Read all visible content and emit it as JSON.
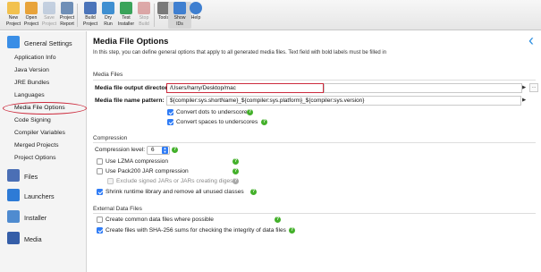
{
  "toolbar": {
    "buttons": [
      {
        "label_1": "New",
        "label_2": "Project",
        "icon": "new-project-icon",
        "color": "#f2c14e",
        "enabled": true
      },
      {
        "label_1": "Open",
        "label_2": "Project",
        "icon": "open-project-icon",
        "color": "#e8a33a",
        "enabled": true
      },
      {
        "label_1": "Save",
        "label_2": "Project",
        "icon": "save-project-icon",
        "color": "#8aa3c7",
        "enabled": false
      },
      {
        "label_1": "Project",
        "label_2": "Report",
        "icon": "project-report-icon",
        "color": "#6f8fb7",
        "enabled": true
      },
      {
        "label_1": "Build",
        "label_2": "Project",
        "icon": "build-project-icon",
        "color": "#4b74b9",
        "enabled": true
      },
      {
        "label_1": "Dry",
        "label_2": "Run",
        "icon": "dry-run-icon",
        "color": "#3f8fd1",
        "enabled": true
      },
      {
        "label_1": "Test",
        "label_2": "Installer",
        "icon": "test-installer-icon",
        "color": "#3aa35a",
        "enabled": true
      },
      {
        "label_1": "Stop",
        "label_2": "Build",
        "icon": "stop-build-icon",
        "color": "#c04b4b",
        "enabled": false
      },
      {
        "label_1": "Tools",
        "label_2": "",
        "icon": "tools-icon",
        "color": "#7a7a7a",
        "enabled": true
      },
      {
        "label_1": "Show",
        "label_2": "IDs",
        "icon": "show-ids-icon",
        "color": "#3f7fd0",
        "enabled": true
      },
      {
        "label_1": "Help",
        "label_2": "",
        "icon": "help-icon",
        "color": "#3f7fd0",
        "enabled": true
      }
    ]
  },
  "sidebar": {
    "groups": [
      {
        "label": "General Settings",
        "icon": "general-settings-icon",
        "color": "#3a8ee6"
      },
      {
        "label": "Files",
        "icon": "files-icon",
        "color": "#4b6fb5"
      },
      {
        "label": "Launchers",
        "icon": "launchers-icon",
        "color": "#2e7bd6"
      },
      {
        "label": "Installer",
        "icon": "installer-icon",
        "color": "#4f8bd0"
      },
      {
        "label": "Media",
        "icon": "media-icon",
        "color": "#355ea8"
      }
    ],
    "items": [
      {
        "label": "Application Info"
      },
      {
        "label": "Java Version"
      },
      {
        "label": "JRE Bundles"
      },
      {
        "label": "Languages"
      },
      {
        "label": "Media File Options"
      },
      {
        "label": "Code Signing"
      },
      {
        "label": "Compiler Variables"
      },
      {
        "label": "Merged Projects"
      },
      {
        "label": "Project Options"
      }
    ]
  },
  "main": {
    "title": "Media File Options",
    "intro": "In this step, you can define general options that apply to all generated media files. Text field with bold labels must be filled in",
    "media_files": {
      "heading": "Media Files",
      "output_dir_label": "Media file output directory:",
      "output_dir_value": "/Users/harry/Desktop/mac",
      "name_pattern_label": "Media file name pattern:",
      "name_pattern_value": "${compiler:sys.shortName}_${compiler:sys.platform}_${compiler:sys.version}",
      "convert_dots": "Convert dots to underscores",
      "convert_spaces": "Convert spaces to underscores"
    },
    "compression": {
      "heading": "Compression",
      "level_label": "Compression level:",
      "level_value": "6",
      "lzma": "Use LZMA compression",
      "pack200": "Use Pack200 JAR compression",
      "exclude_signed": "Exclude signed JARs or JARs creating digests",
      "shrink": "Shrink runtime library and remove all unused classes"
    },
    "external": {
      "heading": "External Data Files",
      "common": "Create common data files where possible",
      "sha256": "Create files with SHA-256 sums for checking the integrity of data files"
    }
  },
  "colors": {
    "highlight": "#cc2b3d",
    "accent": "#2f7cf6",
    "help": "#43b02a"
  }
}
